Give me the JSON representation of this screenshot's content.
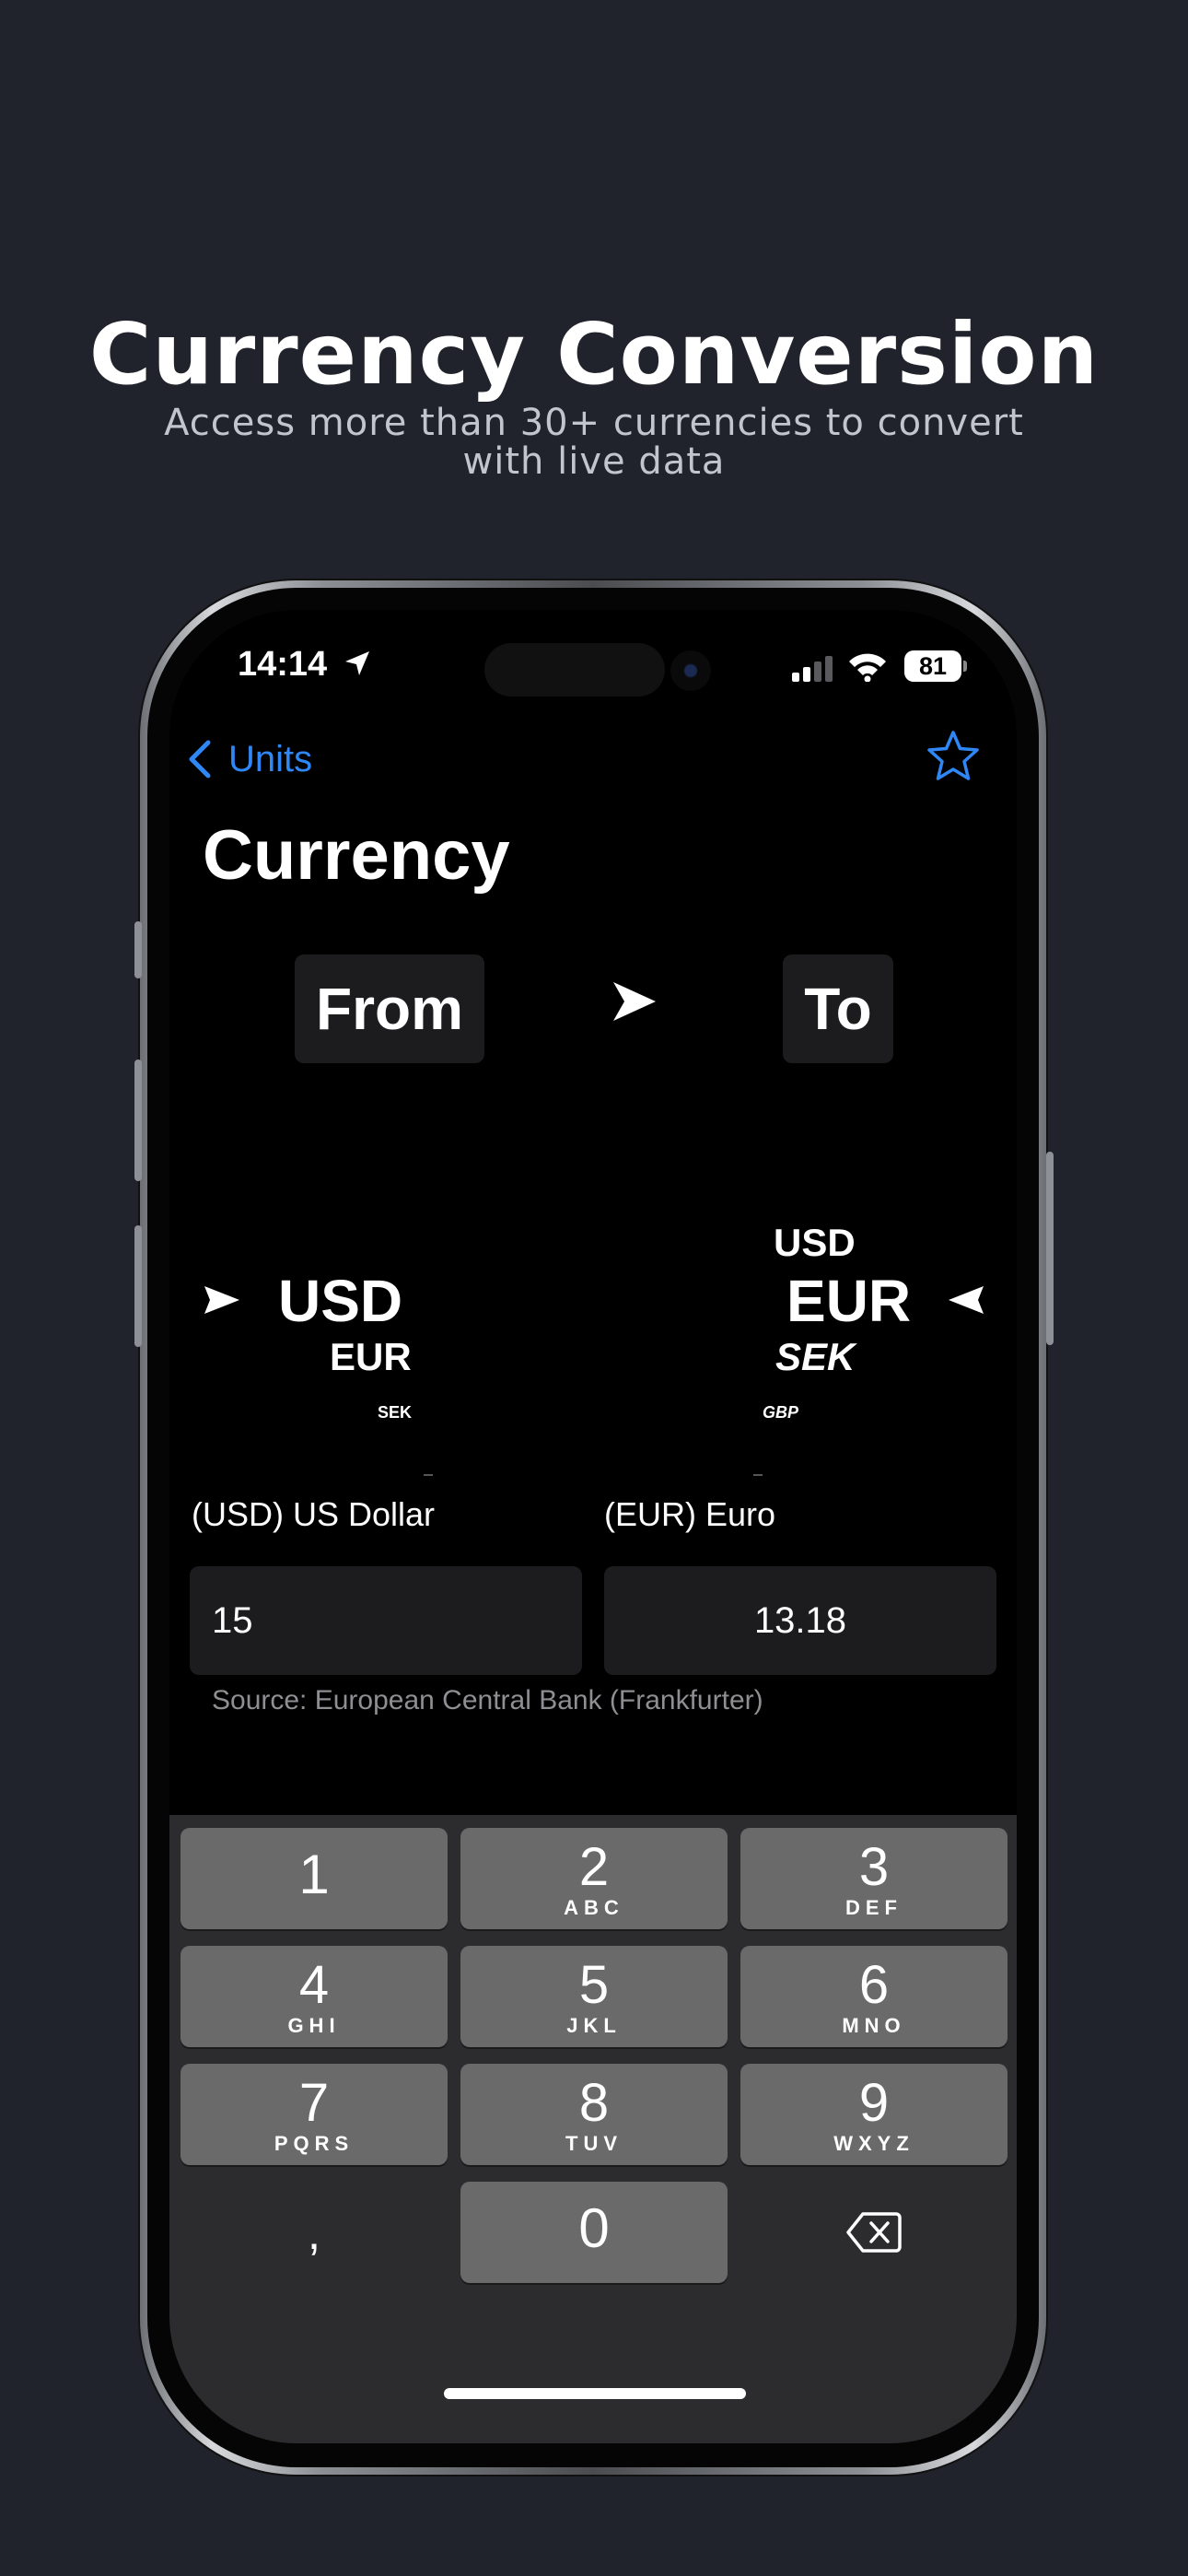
{
  "promo": {
    "headline": "Currency Conversion",
    "subline": "Access more than 30+ currencies to convert with live data"
  },
  "status_bar": {
    "time": "14:14",
    "battery": "81",
    "icons": [
      "location-arrow-icon",
      "cellular-signal-icon",
      "wifi-icon",
      "battery-icon"
    ]
  },
  "nav": {
    "back_label": "Units",
    "favorite_icon": "star-icon"
  },
  "title": "Currency",
  "direction": {
    "from_label": "From",
    "arrow": "➤",
    "to_label": "To"
  },
  "from_picker": {
    "selected": "USD",
    "below": [
      "EUR",
      "SEK"
    ]
  },
  "to_picker": {
    "above": [
      "USD"
    ],
    "selected": "EUR",
    "below": [
      "SEK",
      "GBP"
    ]
  },
  "from_field": {
    "label": "(USD) US Dollar",
    "value": "15"
  },
  "to_field": {
    "label": "(EUR) Euro",
    "value": "13.18"
  },
  "source": "Source: European Central Bank (Frankfurter)",
  "keypad": {
    "keys": [
      {
        "num": "1",
        "letters": ""
      },
      {
        "num": "2",
        "letters": "ABC"
      },
      {
        "num": "3",
        "letters": "DEF"
      },
      {
        "num": "4",
        "letters": "GHI"
      },
      {
        "num": "5",
        "letters": "JKL"
      },
      {
        "num": "6",
        "letters": "MNO"
      },
      {
        "num": "7",
        "letters": "PQRS"
      },
      {
        "num": "8",
        "letters": "TUV"
      },
      {
        "num": "9",
        "letters": "WXYZ"
      }
    ],
    "decimal": ",",
    "zero": "0",
    "delete_icon": "backspace-icon"
  },
  "colors": {
    "background": "#20232b",
    "accent": "#2f87f6",
    "screen": "#000000",
    "key": "#6a6a6b"
  }
}
